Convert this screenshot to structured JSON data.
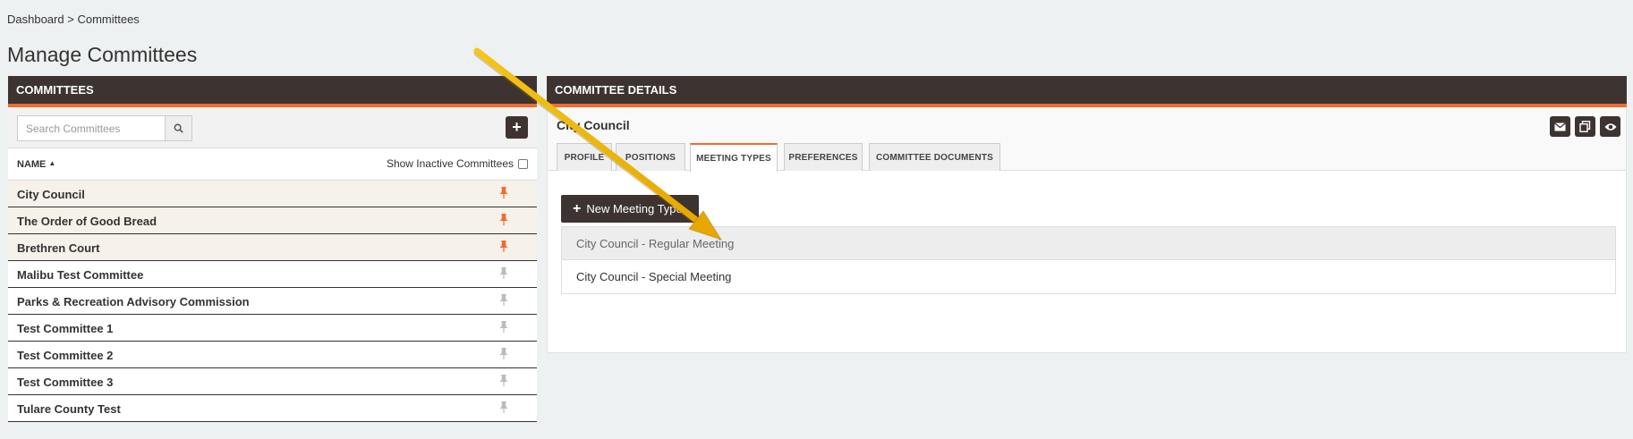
{
  "breadcrumb": {
    "root": "Dashboard",
    "separator": ">",
    "current": "Committees"
  },
  "page": {
    "title": "Manage Committees"
  },
  "left_panel": {
    "title": "COMMITTEES",
    "search_placeholder": "Search Committees",
    "add_label": "+",
    "column_name": "NAME",
    "sort_direction": "ascending",
    "show_inactive_label": "Show Inactive Committees",
    "show_inactive_checked": false,
    "committees": [
      {
        "name": "City Council",
        "pinned": true
      },
      {
        "name": "The Order of Good Bread",
        "pinned": true
      },
      {
        "name": "Brethren Court",
        "pinned": true
      },
      {
        "name": "Malibu Test Committee",
        "pinned": false
      },
      {
        "name": "Parks & Recreation Advisory Commission",
        "pinned": false
      },
      {
        "name": "Test Committee 1",
        "pinned": false
      },
      {
        "name": "Test Committee 2",
        "pinned": false
      },
      {
        "name": "Test Committee 3",
        "pinned": false
      },
      {
        "name": "Tulare County Test",
        "pinned": false
      }
    ]
  },
  "right_panel": {
    "title": "COMMITTEE DETAILS",
    "committee_name": "City Council",
    "action_icons": [
      "envelope-icon",
      "copy-icon",
      "eye-icon"
    ],
    "tabs": [
      {
        "label": "PROFILE",
        "active": false
      },
      {
        "label": "POSITIONS",
        "active": false
      },
      {
        "label": "MEETING TYPES",
        "active": true
      },
      {
        "label": "PREFERENCES",
        "active": false
      },
      {
        "label": "COMMITTEE DOCUMENTS",
        "active": false
      }
    ],
    "new_meeting_type_label": "New Meeting Type",
    "meeting_types": [
      {
        "name": "City Council - Regular Meeting",
        "highlighted": true
      },
      {
        "name": "City Council - Special Meeting",
        "highlighted": false
      }
    ]
  },
  "colors": {
    "header_bg": "#3d3432",
    "accent": "#f26a2e",
    "pin_active": "#f26a2e",
    "pin_inactive": "#bbbbbb",
    "annotation_arrow": "#f2b705"
  }
}
